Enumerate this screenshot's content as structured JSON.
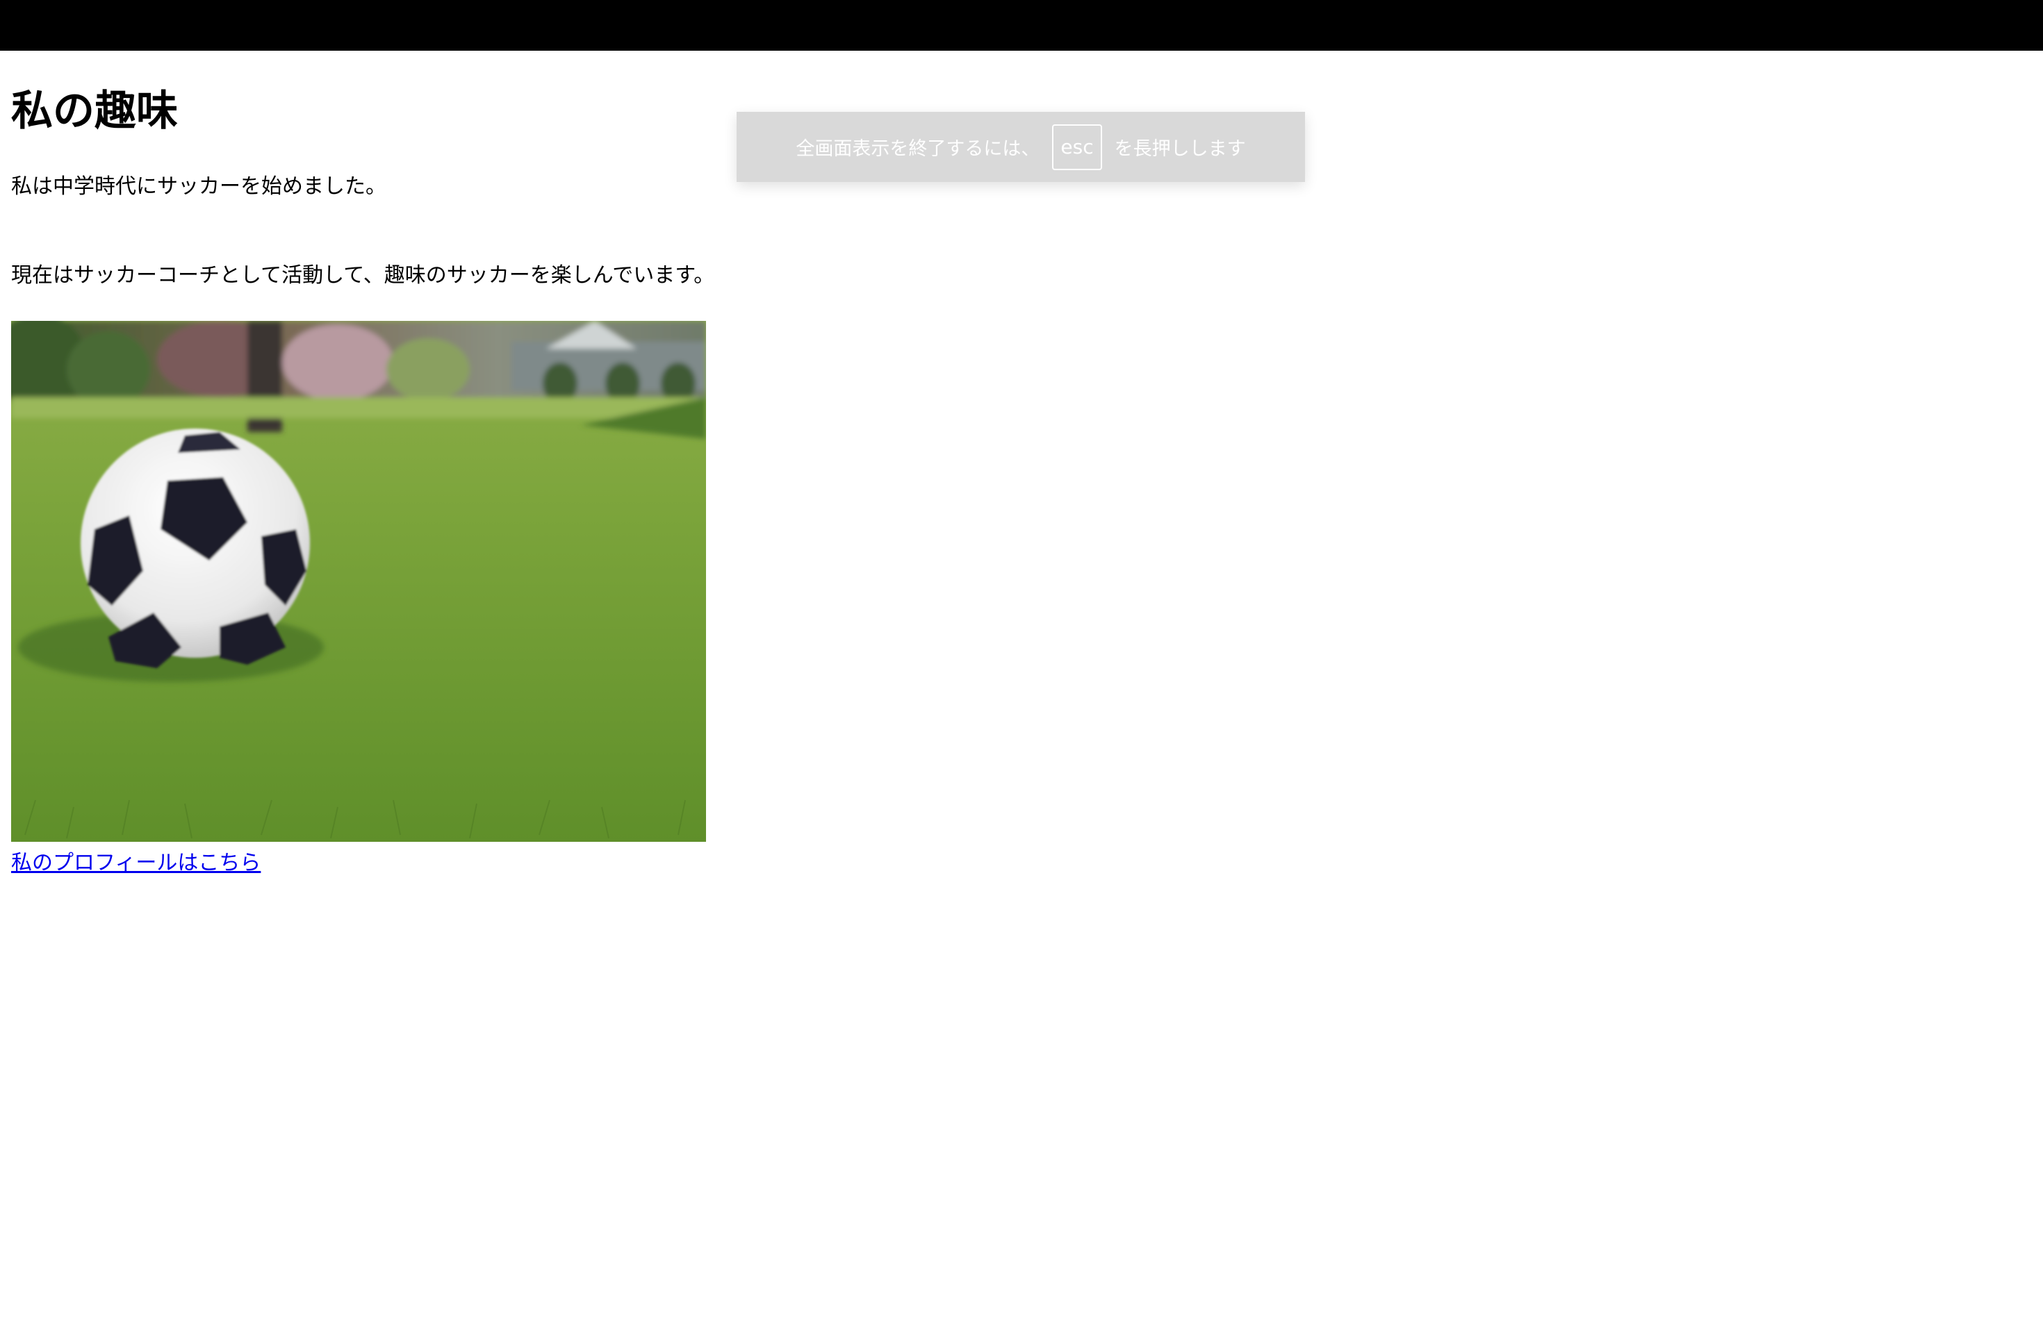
{
  "page": {
    "heading": "私の趣味",
    "paragraph_1": "私は中学時代にサッカーを始めました。",
    "paragraph_2": "現在はサッカーコーチとして活動して、趣味のサッカーを楽しんでいます。",
    "link_text": "私のプロフィールはこちら"
  },
  "fullscreen_notice": {
    "text_before": "全画面表示を終了するには、",
    "key": "esc",
    "text_after": "を長押しします"
  },
  "colors": {
    "topbar": "#000000",
    "link": "#0000ee",
    "toast_bg": "#d9d9d9"
  }
}
